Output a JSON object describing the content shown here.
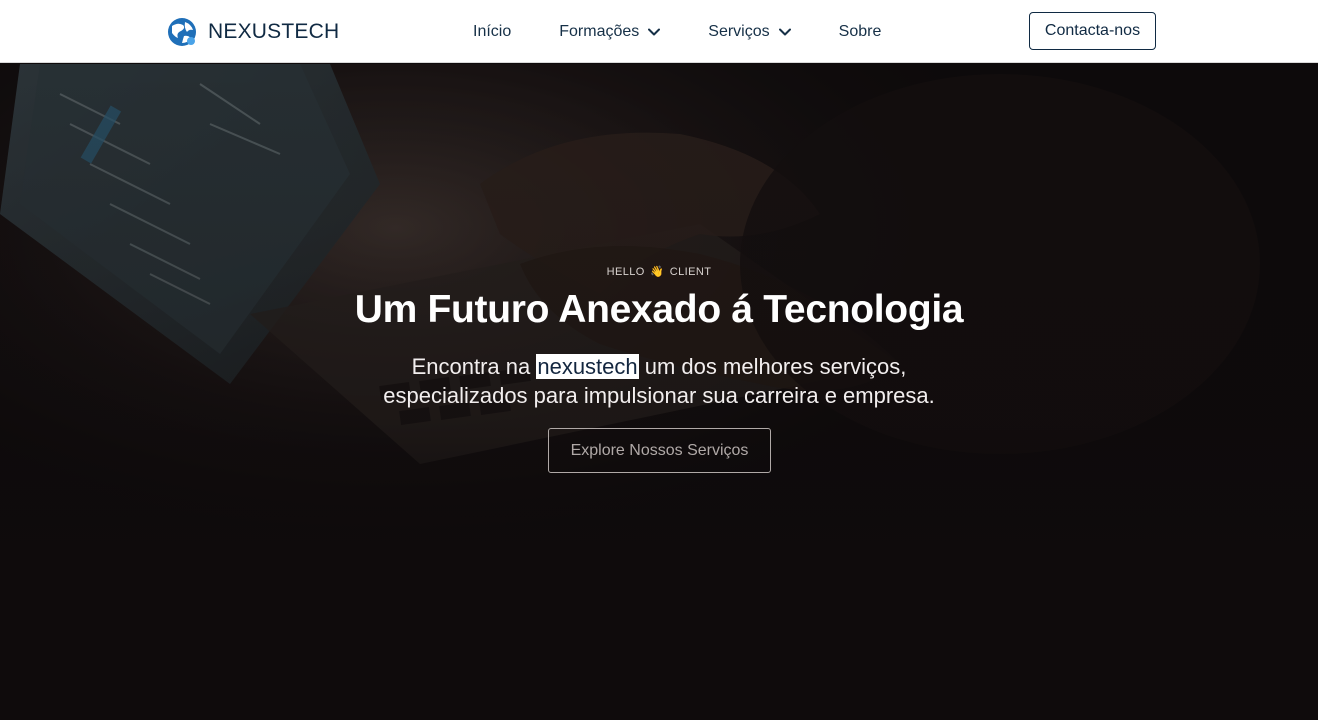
{
  "brand": {
    "name": "NEXUSTECH",
    "logo_icon": "globe-icon"
  },
  "nav": {
    "items": [
      {
        "label": "Início",
        "has_dropdown": false
      },
      {
        "label": "Formações",
        "has_dropdown": true
      },
      {
        "label": "Serviços",
        "has_dropdown": true
      },
      {
        "label": "Sobre",
        "has_dropdown": false
      }
    ],
    "contact_label": "Contacta-nos"
  },
  "hero": {
    "kicker_left": "HELLO",
    "kicker_emoji": "👋",
    "kicker_right": "CLIENT",
    "title": "Um Futuro Anexado á Tecnologia",
    "subtitle_before": "Encontra na ",
    "subtitle_highlight": "nexustech",
    "subtitle_after": " um dos melhores serviços,",
    "subtitle_line2": "especializados para impulsionar sua carreira e empresa.",
    "cta_label": "Explore Nossos Serviços"
  },
  "colors": {
    "header_bg": "#ffffff",
    "brand_text": "#102a43",
    "hero_bg": "#0f0b0c",
    "cta_border": "#b0a9a7"
  }
}
